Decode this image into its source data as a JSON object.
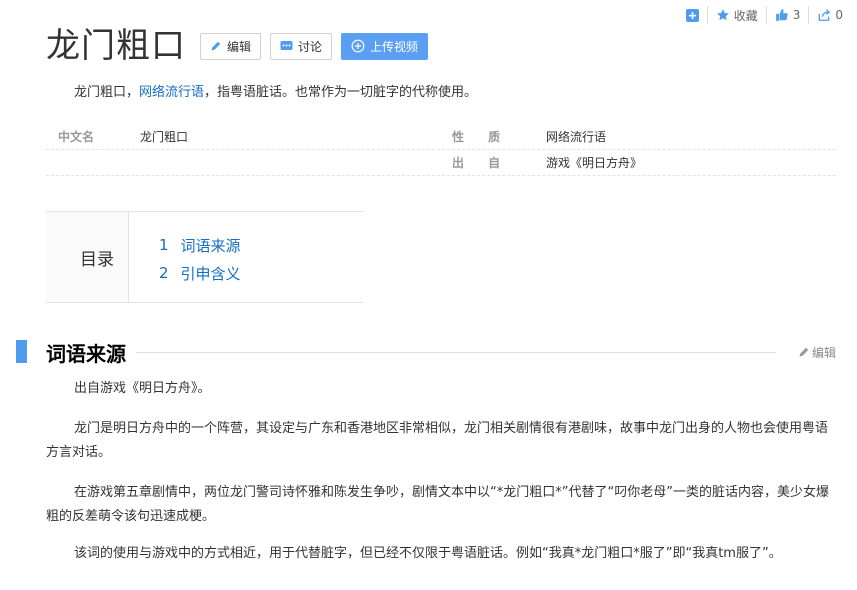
{
  "tools": {
    "add_label": "",
    "favorite_label": "收藏",
    "like_count": "3",
    "share_count": "0"
  },
  "header": {
    "title": "龙门粗口",
    "edit_label": "编辑",
    "discuss_label": "讨论",
    "upload_label": "上传视频"
  },
  "summary": {
    "prefix": "龙门粗口，",
    "link_text": "网络流行语",
    "suffix": "，指粤语脏话。也常作为一切脏字的代称使用。"
  },
  "basic_info": {
    "row1": {
      "name1": "中文名",
      "value1": "龙门粗口",
      "name2": "性 质",
      "value2": "网络流行语"
    },
    "row2": {
      "name2": "出 自",
      "value2": "游戏《明日方舟》"
    }
  },
  "toc": {
    "label": "目录",
    "items": [
      {
        "num": "1",
        "text": "词语来源"
      },
      {
        "num": "2",
        "text": "引申含义"
      }
    ]
  },
  "section1": {
    "title": "词语来源",
    "edit_label": "编辑",
    "paragraphs": [
      "出自游戏《明日方舟》。",
      "龙门是明日方舟中的一个阵营，其设定与广东和香港地区非常相似，龙门相关剧情很有港剧味，故事中龙门出身的人物也会使用粤语方言对话。",
      "在游戏第五章剧情中，两位龙门警司诗怀雅和陈发生争吵，剧情文本中以“*龙门粗口*”代替了“叼你老母”一类的脏话内容，美少女爆粗的反差萌令该句迅速成梗。",
      "该词的使用与游戏中的方式相近，用于代替脏字，但已经不仅限于粤语脏话。例如“我真*龙门粗口*服了”即“我真tm服了”。"
    ]
  },
  "colors": {
    "accent": "#4f9cee",
    "link": "#136ec2",
    "upload_button": "#5b9ff2"
  }
}
